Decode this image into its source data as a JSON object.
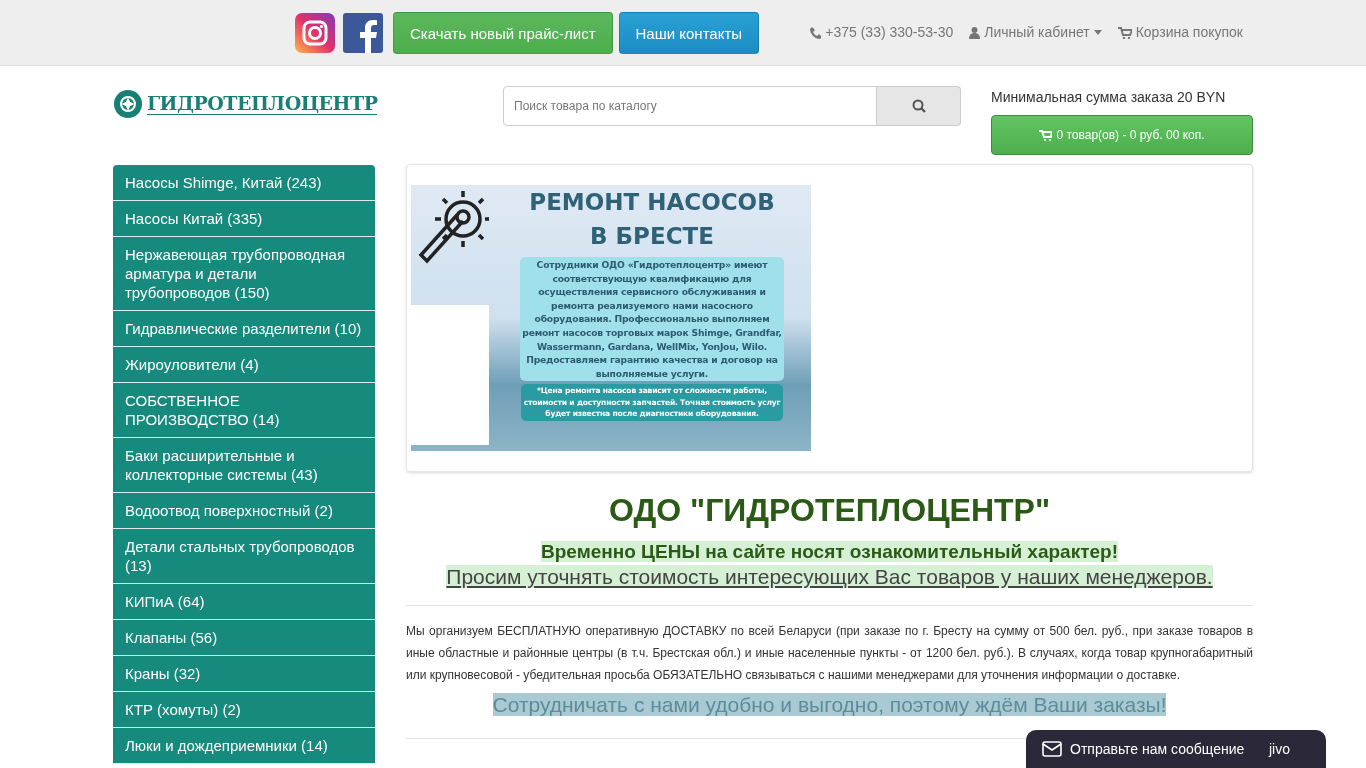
{
  "topbar": {
    "social": [
      {
        "kind": "instagram"
      },
      {
        "kind": "facebook"
      }
    ],
    "buttons": [
      {
        "label": "Скачать новый прайс-лист",
        "kind": "success"
      },
      {
        "label": "Наши контакты",
        "kind": "info"
      }
    ],
    "phone": "+375 (33) 330-53-30",
    "account": "Личный кабинет",
    "cart_link": "Корзина покупок"
  },
  "header": {
    "logo_text": "ГИДРОТЕПЛОЦЕНТР",
    "search": {
      "placeholder": "Поиск товара по каталогу"
    },
    "min_order": "Минимальная сумма заказа 20 BYN",
    "cart_button": "0 товар(ов) - 0 руб. 00 коп."
  },
  "sidebar": {
    "items": [
      {
        "label": "Насосы Shimge, Китай (243)"
      },
      {
        "label": "Насосы Китай (335)"
      },
      {
        "label": "Нержавеющая трубопроводная арматура и детали трубопроводов (150)"
      },
      {
        "label": "Гидравлические разделители (10)"
      },
      {
        "label": "Жироуловители (4)"
      },
      {
        "label": "СОБСТВЕННОЕ ПРОИЗВОДСТВО (14)"
      },
      {
        "label": "Баки расширительные и коллекторные системы (43)"
      },
      {
        "label": "Водоотвод поверхностный (2)"
      },
      {
        "label": "Детали стальных трубопроводов (13)"
      },
      {
        "label": "КИПиА (64)"
      },
      {
        "label": "Клапаны (56)"
      },
      {
        "label": "Краны (32)"
      },
      {
        "label": "КТР (хомуты) (2)"
      },
      {
        "label": "Люки и дождеприемники (14)"
      }
    ]
  },
  "banner": {
    "title_lines": [
      "РЕМОНТ НАСОСОВ",
      "В БРЕСТЕ"
    ],
    "text_lines": [
      "Сотрудники ОДО «Гидротеплоцентр» имеют",
      "соответствующую квалификацию для",
      "осуществления сервисного обслуживания и",
      "ремонта реализуемого нами насосного",
      "оборудования. Профессионально выполняем",
      "ремонт насосов торговых марок Shimge, Grandfar,",
      "Wassermann, Gardana, WellMix, YonJou, Wilo.",
      "Предоставляем гарантию качества и договор на",
      "выполняемые услуги."
    ],
    "note_lines": [
      "*Цена ремонта насосов зависит от сложности работы,",
      "стоимости и доступности запчастей. Точная стоимость услуг",
      "будет известна после диагностики оборудования."
    ]
  },
  "content": {
    "heading": "ОДО \"ГИДРОТЕПЛОЦЕНТР\"",
    "notice": "Временно ЦЕНЫ на сайте носят ознакомительный характер!",
    "notice_link": "Просим уточнять стоимость интересующих Вас товаров у наших менеджеров.",
    "delivery": "Мы организуем БЕСПЛАТНУЮ оперативную ДОСТАВКУ по всей Беларуси (при заказе по г. Бресту на сумму от 500 бел. руб., при заказе товаров в иные областные и районные центры (в т.ч. Брестская обл.) и иные населенные пункты - от 1200 бел. руб.). В случаях, когда товар крупногабаритный или крупновесовой - убедительная просьба ОБЯЗАТЕЛЬНО связываться с нашими менеджерами для уточнения информации о доставке.",
    "slogan": "Сотрудничать с нами удобно и выгодно, поэтому ждём Ваши заказы!"
  },
  "chat": {
    "label": "Отправьте нам сообщение",
    "brand": "jivo"
  }
}
